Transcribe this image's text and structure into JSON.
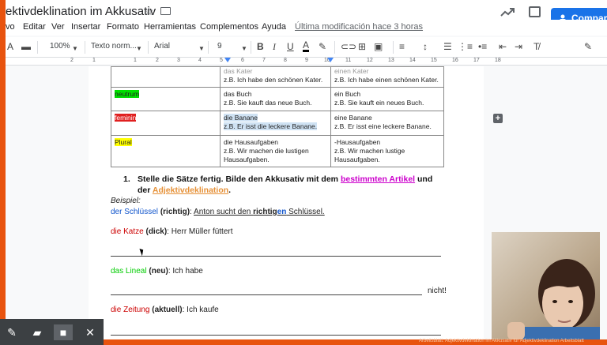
{
  "title_bar": {
    "doc_title": "ektivdeklination im Akkusativ",
    "share_label": "Compar"
  },
  "menu": {
    "items": [
      "vo",
      "Editar",
      "Ver",
      "Insertar",
      "Formato",
      "Herramientas",
      "Complementos",
      "Ayuda"
    ],
    "last_edit": "Última modificación hace 3 horas"
  },
  "toolbar": {
    "zoom": "100%",
    "style": "Texto norm...",
    "font": "Arial",
    "font_size": "9"
  },
  "ruler": {
    "numbers": [
      "2",
      "1",
      "1",
      "2",
      "3",
      "4",
      "5",
      "6",
      "7",
      "8",
      "9",
      "10",
      "11",
      "12",
      "13",
      "14",
      "15",
      "16",
      "17",
      "18"
    ]
  },
  "table": {
    "rows": [
      {
        "gender": "",
        "def_1": "das Kater",
        "def_2": "z.B. Ich habe den schönen Kater.",
        "indef_1": "einen Kater",
        "indef_2": "z.B. Ich habe einen schönen Kater."
      },
      {
        "gender": "neutrum",
        "def_1": "das Buch",
        "def_2": "z.B. Sie kauft das neue Buch.",
        "indef_1": "ein Buch",
        "indef_2": "z.B. Sie kauft ein neues Buch."
      },
      {
        "gender": "feminin",
        "def_1": "die Banane",
        "def_2": "z.B. Er isst die leckere Banane.",
        "indef_1": "eine Banane",
        "indef_2": "z.B. Er isst eine leckere Banane."
      },
      {
        "gender": "Plural",
        "def_1": "die Hausaufgaben",
        "def_2": "z.B. Wir machen die lustigen",
        "def_3": "Hausaufgaben.",
        "indef_1": "-Hausaufgaben",
        "indef_2": "z.B. Wir machen lustige",
        "indef_3": "Hausaufgaben."
      }
    ]
  },
  "task": {
    "number": "1.",
    "text_a": "Stelle die Sätze fertig. Bilde den Akkusativ mit dem ",
    "link_a": "bestimmten Artikel",
    "text_b": " und der ",
    "link_b": "Adjektivdeklination",
    "text_c": "."
  },
  "example": {
    "label": "Beispiel:",
    "noun": "der Schlüssel",
    "adj": "(richtig)",
    "colon": ":",
    "sentence_a": "Anton sucht den ",
    "sentence_b": "richtig",
    "sentence_c": "en",
    "sentence_d": " Schlüssel."
  },
  "exercises": [
    {
      "noun": "die Katze",
      "adj": "(dick)",
      "rest": ": Herr Müller füttert",
      "end": ""
    },
    {
      "noun": "das Lineal",
      "adj": "(neu)",
      "rest": ": Ich habe",
      "end": "nicht!"
    },
    {
      "noun": "die Zeitung",
      "adj": "(aktuell)",
      "rest": ": Ich kaufe",
      "end": ""
    }
  ],
  "watermark": "Arbeitsblatt: Adjektivdeklination im Akkusativ für Adjektivdeklination Arbeitsblatt",
  "colors": {
    "frame": "#e8530e",
    "share": "#1a73e8",
    "highlight_green": "#00e000",
    "highlight_red": "#e02020",
    "highlight_yellow": "#ffff00"
  }
}
